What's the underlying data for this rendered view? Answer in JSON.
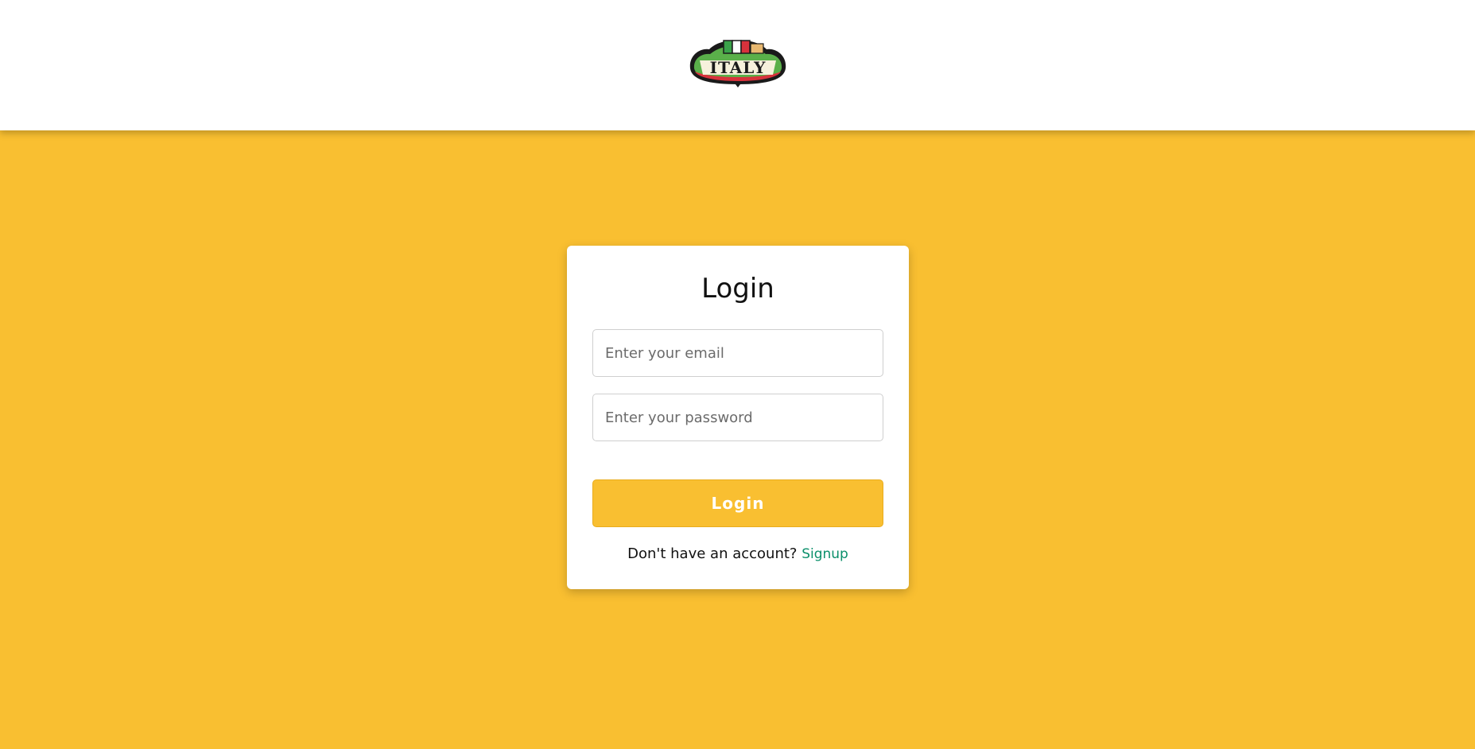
{
  "header": {
    "logo_text": "ITALY"
  },
  "login_card": {
    "title": "Login",
    "email_placeholder": "Enter your email",
    "password_placeholder": "Enter your password",
    "login_button_label": "Login",
    "signup_prompt": "Don't have an account?",
    "signup_link_label": "Signup"
  },
  "colors": {
    "background": "#f9bf31",
    "accent": "#f9bf31",
    "link": "#0a8f6a"
  }
}
